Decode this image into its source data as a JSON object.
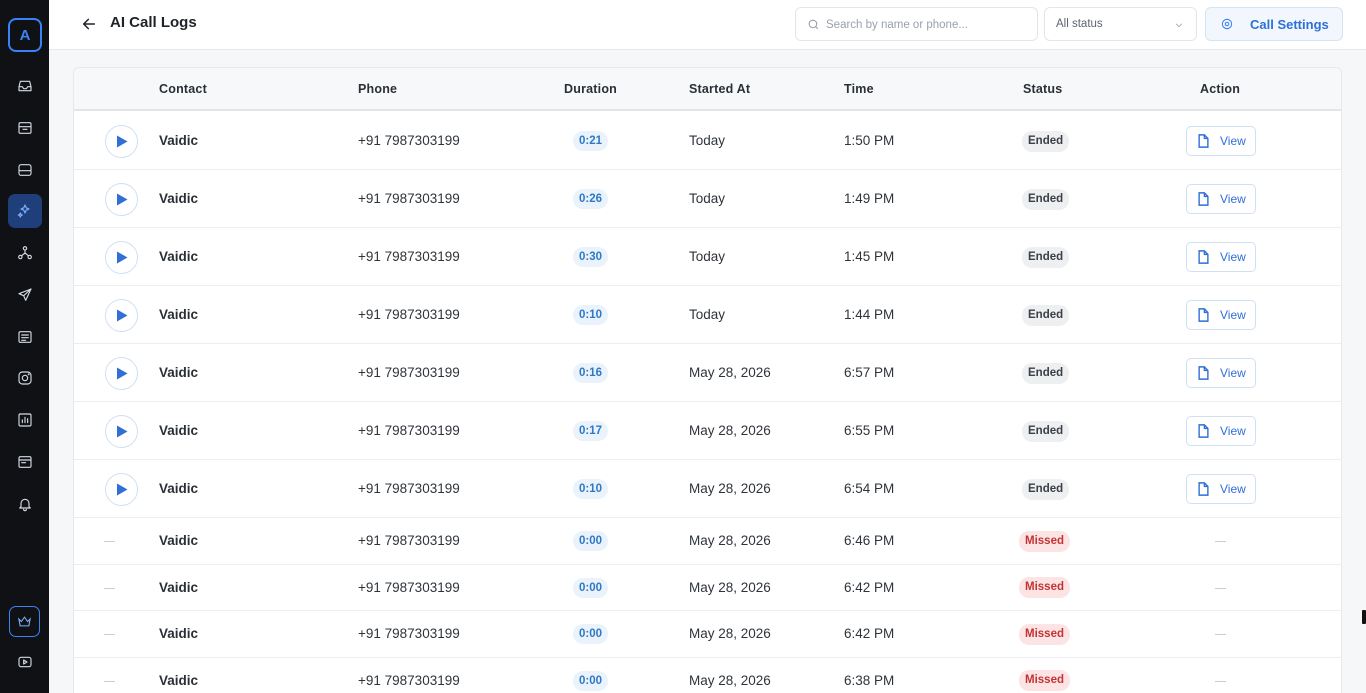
{
  "sidebar": {
    "logo_letter": "A",
    "icons": [
      "inbox-icon",
      "archive-icon",
      "database-icon",
      "sparkles-icon",
      "network-icon",
      "send-icon",
      "list-icon",
      "instagram-icon",
      "chart-icon",
      "window-icon",
      "bell-icon",
      "crown-icon",
      "video-icon"
    ],
    "active_icon": "sparkles-icon"
  },
  "header": {
    "title": "AI Call Logs",
    "search_placeholder": "Search by name or phone...",
    "status_filter": "All status",
    "call_settings_label": "Call Settings"
  },
  "table": {
    "columns": {
      "contact": "Contact",
      "phone": "Phone",
      "duration": "Duration",
      "started_at": "Started At",
      "time": "Time",
      "status": "Status",
      "action": "Action"
    },
    "view_label": "View",
    "rows": [
      {
        "contact": "Vaidic",
        "phone": "+91 7987303199",
        "duration": "0:21",
        "started_at": "Today",
        "time": "1:50 PM",
        "status": "Ended",
        "has_recording": true
      },
      {
        "contact": "Vaidic",
        "phone": "+91 7987303199",
        "duration": "0:26",
        "started_at": "Today",
        "time": "1:49 PM",
        "status": "Ended",
        "has_recording": true
      },
      {
        "contact": "Vaidic",
        "phone": "+91 7987303199",
        "duration": "0:30",
        "started_at": "Today",
        "time": "1:45 PM",
        "status": "Ended",
        "has_recording": true
      },
      {
        "contact": "Vaidic",
        "phone": "+91 7987303199",
        "duration": "0:10",
        "started_at": "Today",
        "time": "1:44 PM",
        "status": "Ended",
        "has_recording": true
      },
      {
        "contact": "Vaidic",
        "phone": "+91 7987303199",
        "duration": "0:16",
        "started_at": "May 28, 2026",
        "time": "6:57 PM",
        "status": "Ended",
        "has_recording": true
      },
      {
        "contact": "Vaidic",
        "phone": "+91 7987303199",
        "duration": "0:17",
        "started_at": "May 28, 2026",
        "time": "6:55 PM",
        "status": "Ended",
        "has_recording": true
      },
      {
        "contact": "Vaidic",
        "phone": "+91 7987303199",
        "duration": "0:10",
        "started_at": "May 28, 2026",
        "time": "6:54 PM",
        "status": "Ended",
        "has_recording": true
      },
      {
        "contact": "Vaidic",
        "phone": "+91 7987303199",
        "duration": "0:00",
        "started_at": "May 28, 2026",
        "time": "6:46 PM",
        "status": "Missed",
        "has_recording": false
      },
      {
        "contact": "Vaidic",
        "phone": "+91 7987303199",
        "duration": "0:00",
        "started_at": "May 28, 2026",
        "time": "6:42 PM",
        "status": "Missed",
        "has_recording": false
      },
      {
        "contact": "Vaidic",
        "phone": "+91 7987303199",
        "duration": "0:00",
        "started_at": "May 28, 2026",
        "time": "6:42 PM",
        "status": "Missed",
        "has_recording": false
      },
      {
        "contact": "Vaidic",
        "phone": "+91 7987303199",
        "duration": "0:00",
        "started_at": "May 28, 2026",
        "time": "6:38 PM",
        "status": "Missed",
        "has_recording": false
      }
    ]
  },
  "colors": {
    "accent": "#2f6fd6",
    "sidebar_bg": "#0f1115",
    "missed": "#c23434",
    "duration_badge": "#eaf3fb"
  }
}
